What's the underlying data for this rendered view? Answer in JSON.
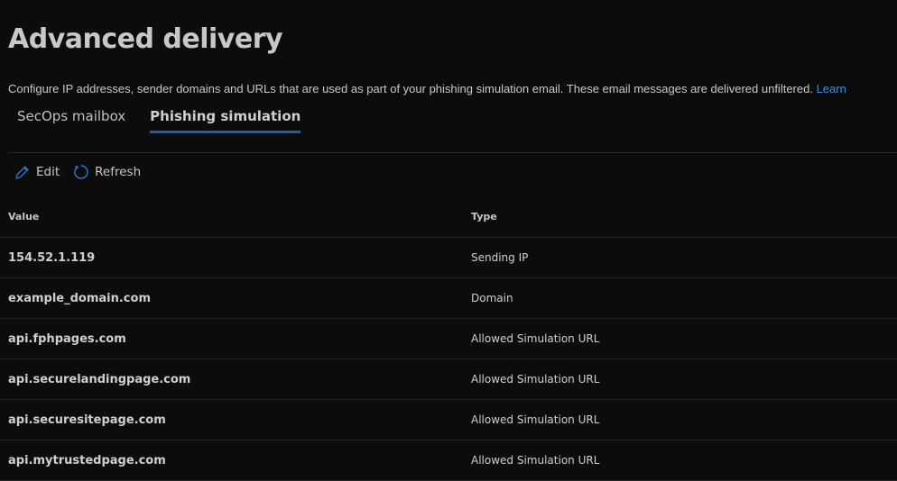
{
  "title": "Advanced delivery",
  "description": "Configure IP addresses, sender domains and URLs that are used as part of your phishing simulation email. These email messages are delivered unfiltered.",
  "learn_link": "Learn",
  "tabs": [
    {
      "label": "SecOps mailbox"
    },
    {
      "label": "Phishing simulation"
    }
  ],
  "toolbar": {
    "edit": "Edit",
    "refresh": "Refresh"
  },
  "table": {
    "headers": {
      "value": "Value",
      "type": "Type"
    },
    "rows": [
      {
        "value": "154.52.1.119",
        "type": "Sending IP"
      },
      {
        "value": "example_domain.com",
        "type": "Domain"
      },
      {
        "value": "api.fphpages.com",
        "type": "Allowed Simulation URL"
      },
      {
        "value": "api.securelandingpage.com",
        "type": "Allowed Simulation URL"
      },
      {
        "value": "api.securesitepage.com",
        "type": "Allowed Simulation URL"
      },
      {
        "value": "api.mytrustedpage.com",
        "type": "Allowed Simulation URL"
      }
    ]
  },
  "colors": {
    "accent": "#1a5fa8",
    "link": "#3b8fd8"
  }
}
